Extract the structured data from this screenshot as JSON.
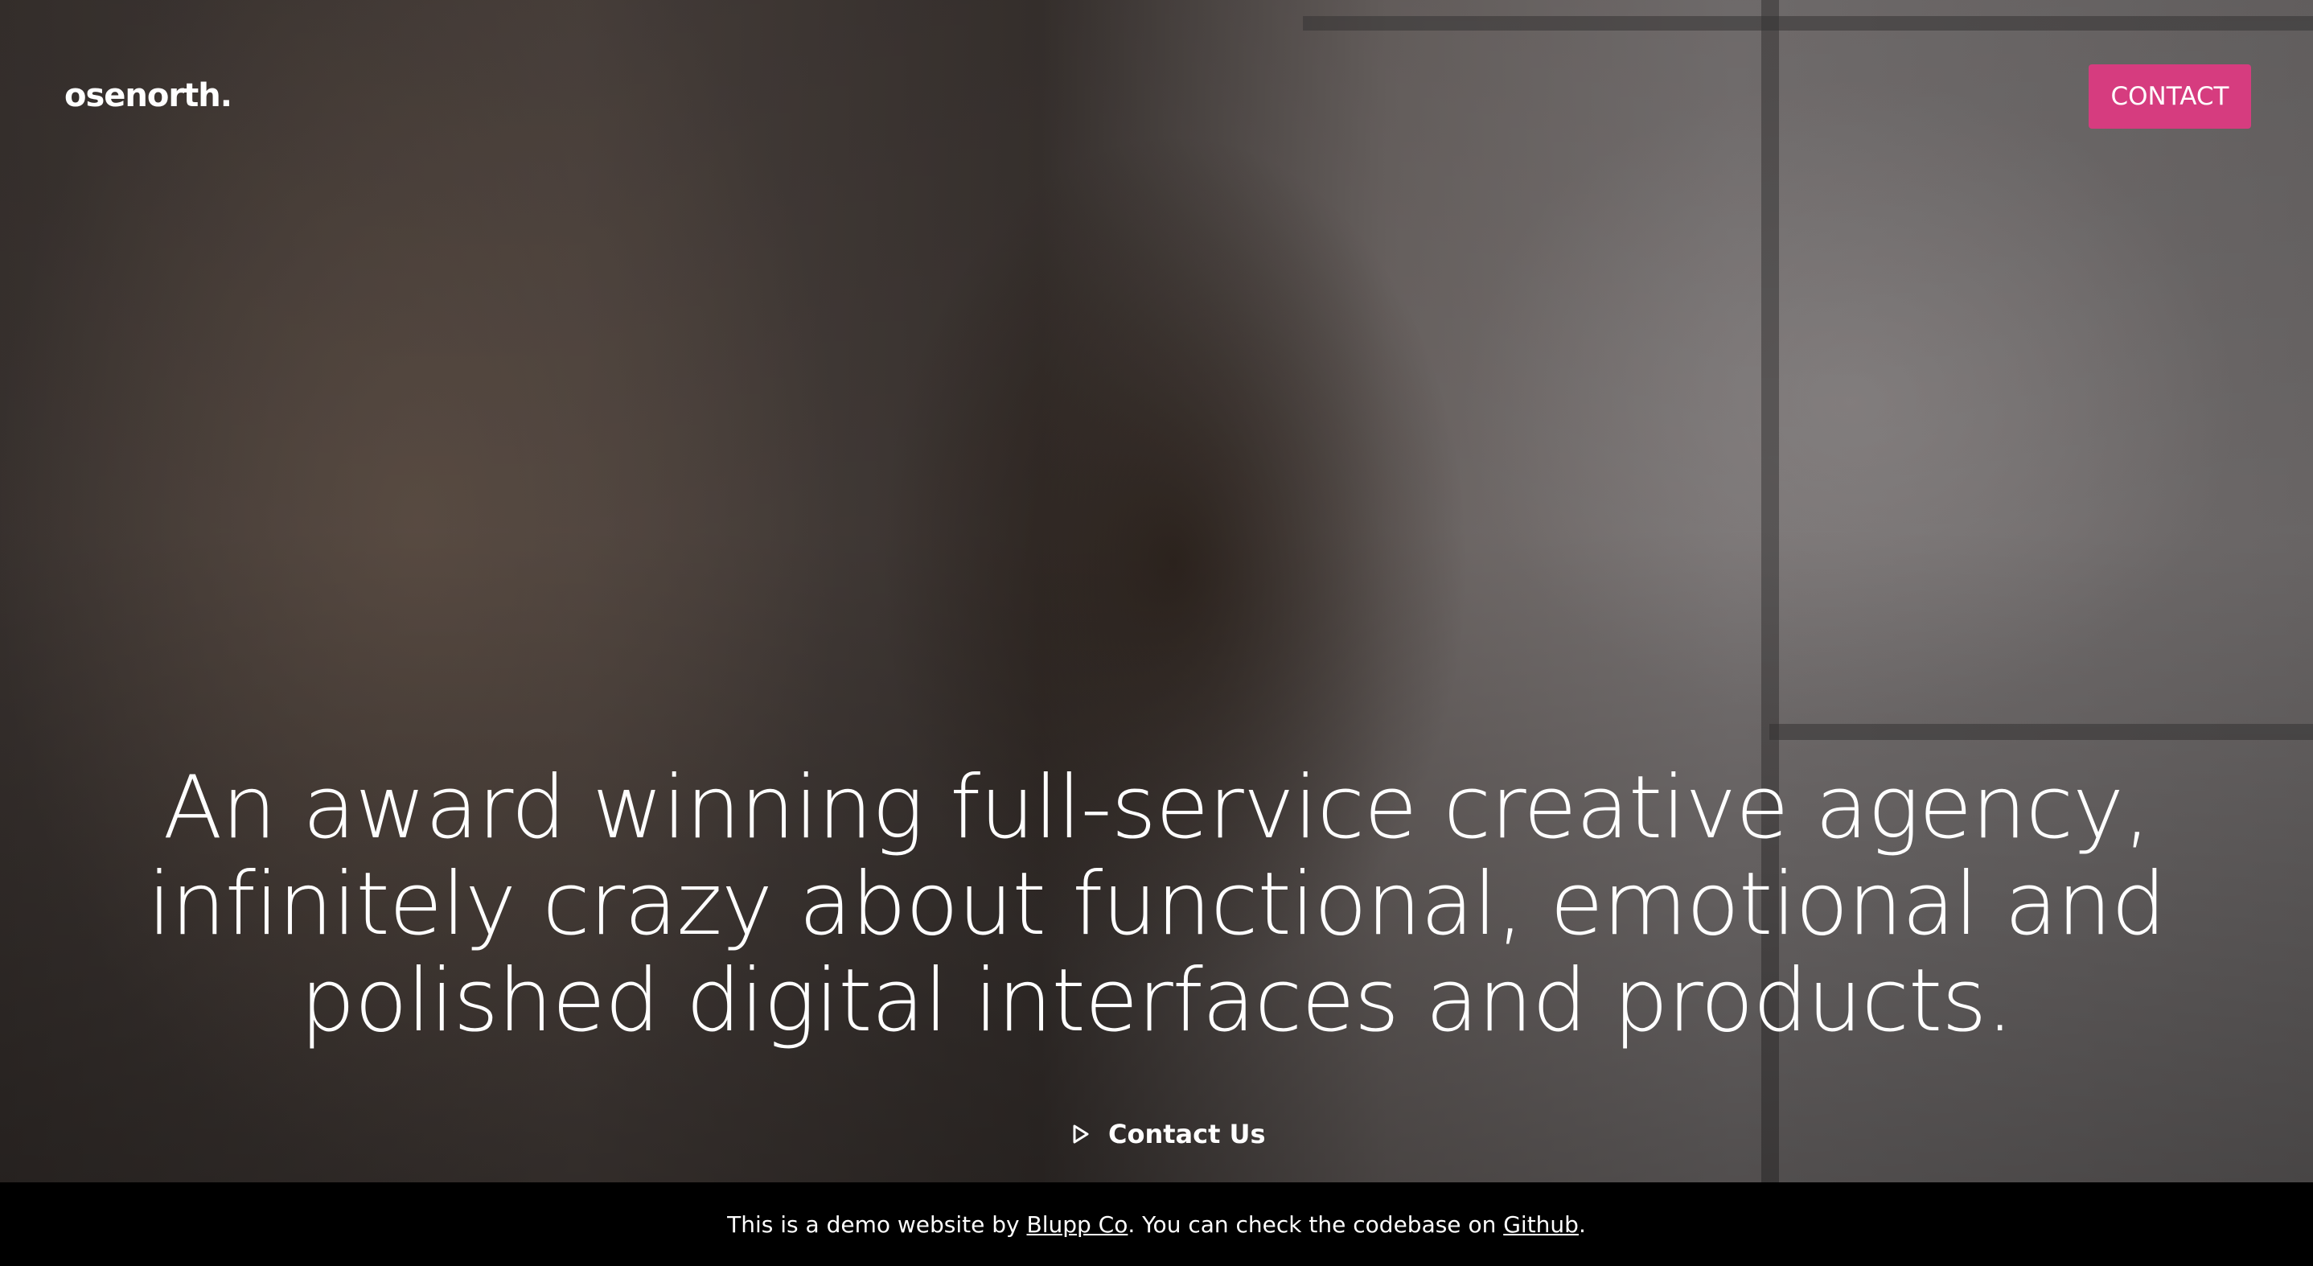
{
  "header": {
    "logo_text": "osenorth.",
    "contact_label": "CONTACT"
  },
  "hero": {
    "headline": "An award winning full-service creative agency, infinitely crazy about functional, emotional and polished digital interfaces and products.",
    "cta_label": "Contact Us",
    "cta_icon": "play-triangle-icon"
  },
  "footer": {
    "text_before": "This is a demo website by ",
    "link1_label": "Blupp Co",
    "text_middle": ". You can check the codebase on ",
    "link2_label": "Github",
    "text_after": "."
  },
  "colors": {
    "accent": "#d63c7f",
    "footer_bg": "#000000",
    "text": "#ffffff"
  }
}
